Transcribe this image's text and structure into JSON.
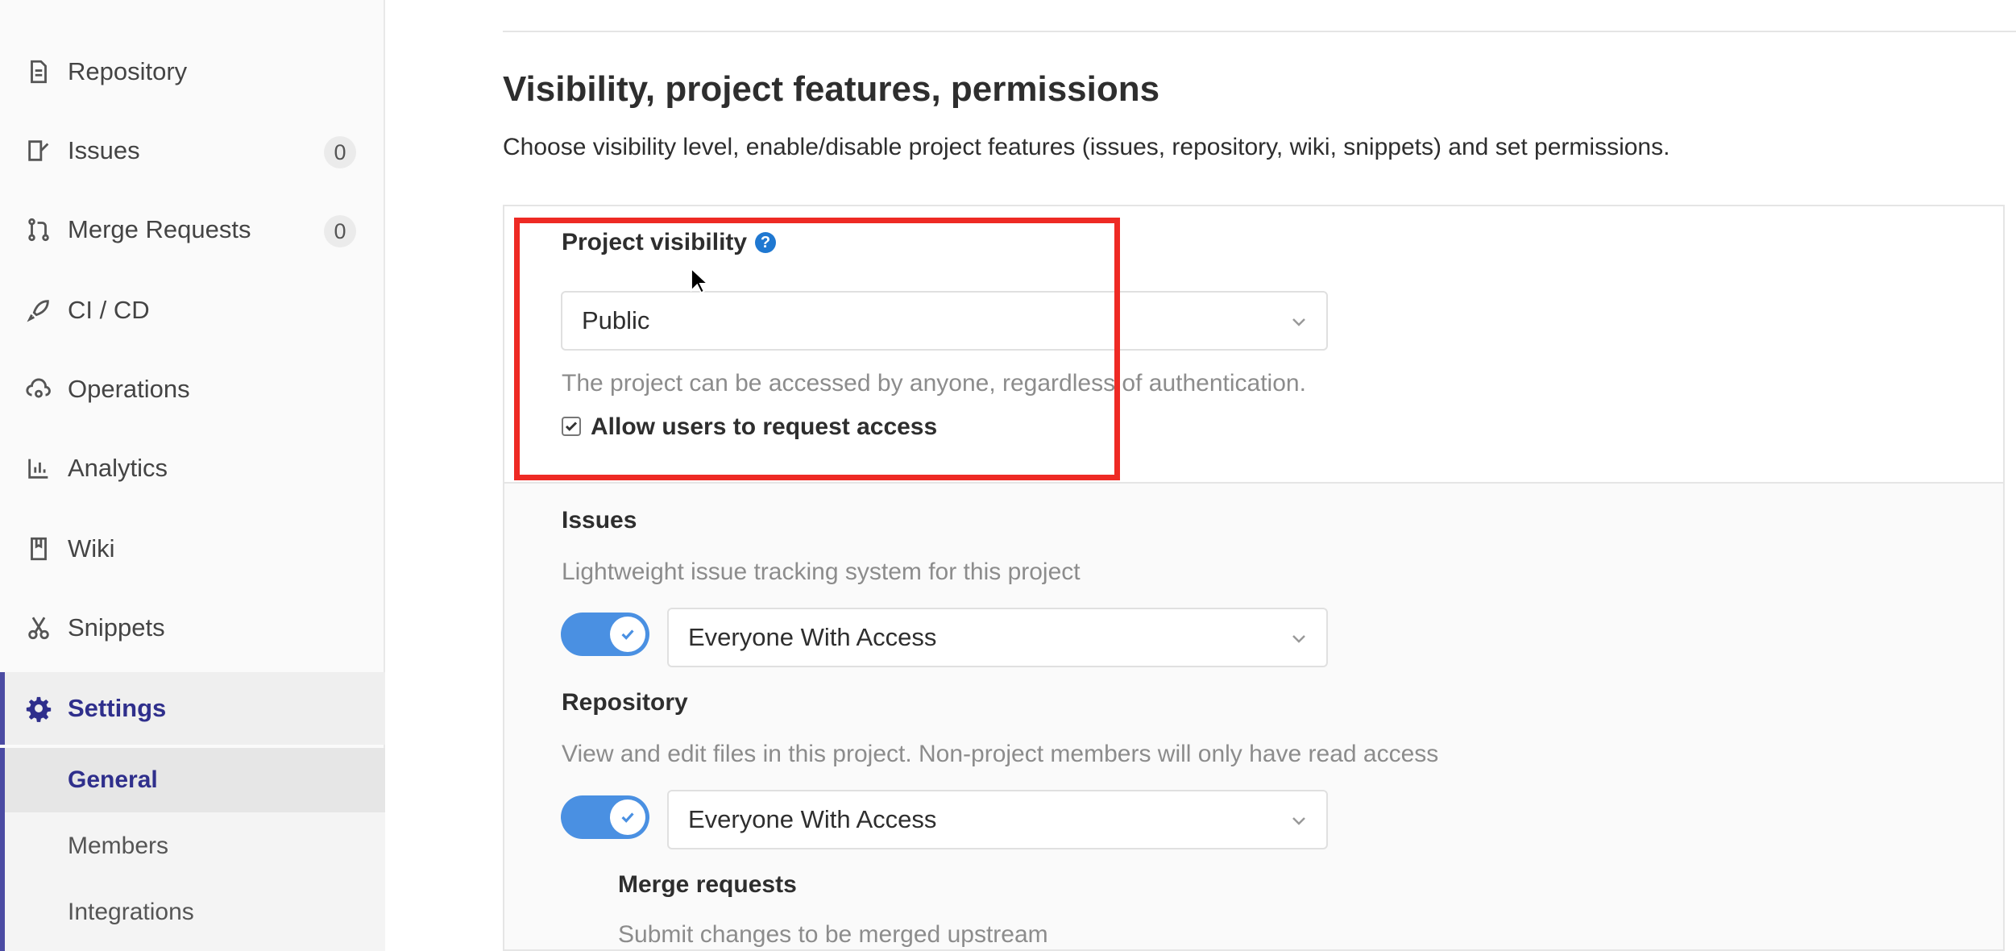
{
  "sidebar": {
    "items": [
      {
        "name": "repository",
        "label": "Repository",
        "icon": "document-icon"
      },
      {
        "name": "issues",
        "label": "Issues",
        "icon": "issues-icon",
        "badge": "0"
      },
      {
        "name": "merge-requests",
        "label": "Merge Requests",
        "icon": "merge-request-icon",
        "badge": "0"
      },
      {
        "name": "ci-cd",
        "label": "CI / CD",
        "icon": "rocket-icon"
      },
      {
        "name": "operations",
        "label": "Operations",
        "icon": "cloud-gear-icon"
      },
      {
        "name": "analytics",
        "label": "Analytics",
        "icon": "bar-chart-icon"
      },
      {
        "name": "wiki",
        "label": "Wiki",
        "icon": "book-icon"
      },
      {
        "name": "snippets",
        "label": "Snippets",
        "icon": "scissors-icon"
      },
      {
        "name": "settings",
        "label": "Settings",
        "icon": "gear-icon"
      }
    ],
    "sub_items": [
      {
        "label": "General"
      },
      {
        "label": "Members"
      },
      {
        "label": "Integrations"
      }
    ]
  },
  "main": {
    "title": "Visibility, project features, permissions",
    "description": "Choose visibility level, enable/disable project features (issues, repository, wiki, snippets) and set permissions.",
    "visibility": {
      "label": "Project visibility",
      "help_glyph": "?",
      "selected": "Public",
      "help_text": "The project can be accessed by anyone, regardless of authentication.",
      "request_access_label": "Allow users to request access",
      "request_access_checked": true
    },
    "features": [
      {
        "title": "Issues",
        "description": "Lightweight issue tracking system for this project",
        "access": "Everyone With Access",
        "enabled": true
      },
      {
        "title": "Repository",
        "description": "View and edit files in this project. Non-project members will only have read access",
        "access": "Everyone With Access",
        "enabled": true
      }
    ],
    "merge_requests": {
      "title": "Merge requests",
      "description": "Submit changes to be merged upstream"
    }
  },
  "colors": {
    "accent": "#4b4ba3",
    "toggle": "#4a90e2",
    "highlight": "#ee2a24",
    "help": "#1f78d1"
  }
}
